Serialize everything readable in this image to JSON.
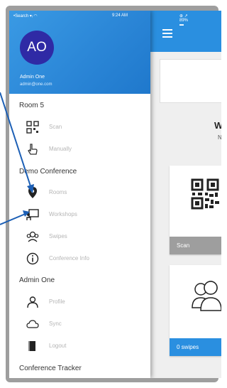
{
  "status_bar": {
    "carrier": "•Search ▾ᵢ ◠",
    "time": "9:24 AM",
    "battery": "⊕ ↗ 89% ▬"
  },
  "drawer": {
    "avatar_initials": "AO",
    "user_name": "Admin One",
    "user_email": "admin@one.com",
    "sections": [
      {
        "title": "Room 5",
        "items": [
          {
            "label": "Scan",
            "icon": "qr-code-icon"
          },
          {
            "label": "Manually",
            "icon": "hand-pointer-icon"
          }
        ]
      },
      {
        "title": "Demo Conference",
        "items": [
          {
            "label": "Rooms",
            "icon": "map-pin-icon"
          },
          {
            "label": "Workshops",
            "icon": "presentation-icon"
          },
          {
            "label": "Swipes",
            "icon": "people-group-icon"
          },
          {
            "label": "Conference Info",
            "icon": "info-icon"
          }
        ]
      },
      {
        "title": "Admin One",
        "items": [
          {
            "label": "Profile",
            "icon": "person-icon"
          },
          {
            "label": "Sync",
            "icon": "cloud-icon"
          },
          {
            "label": "Logout",
            "icon": "logout-door-icon"
          }
        ]
      },
      {
        "title": "Conference Tracker",
        "items": []
      }
    ]
  },
  "main": {
    "welcome": "We",
    "welcome_sub": "N",
    "cards": [
      {
        "label": "Scan",
        "icon": "qr-code-icon"
      },
      {
        "label": "0 swipes",
        "icon": "people-group-icon"
      }
    ]
  },
  "colors": {
    "primary": "#2a8fe0",
    "avatar": "#2f2aa5",
    "annotation_arrow": "#1c5fb5"
  }
}
